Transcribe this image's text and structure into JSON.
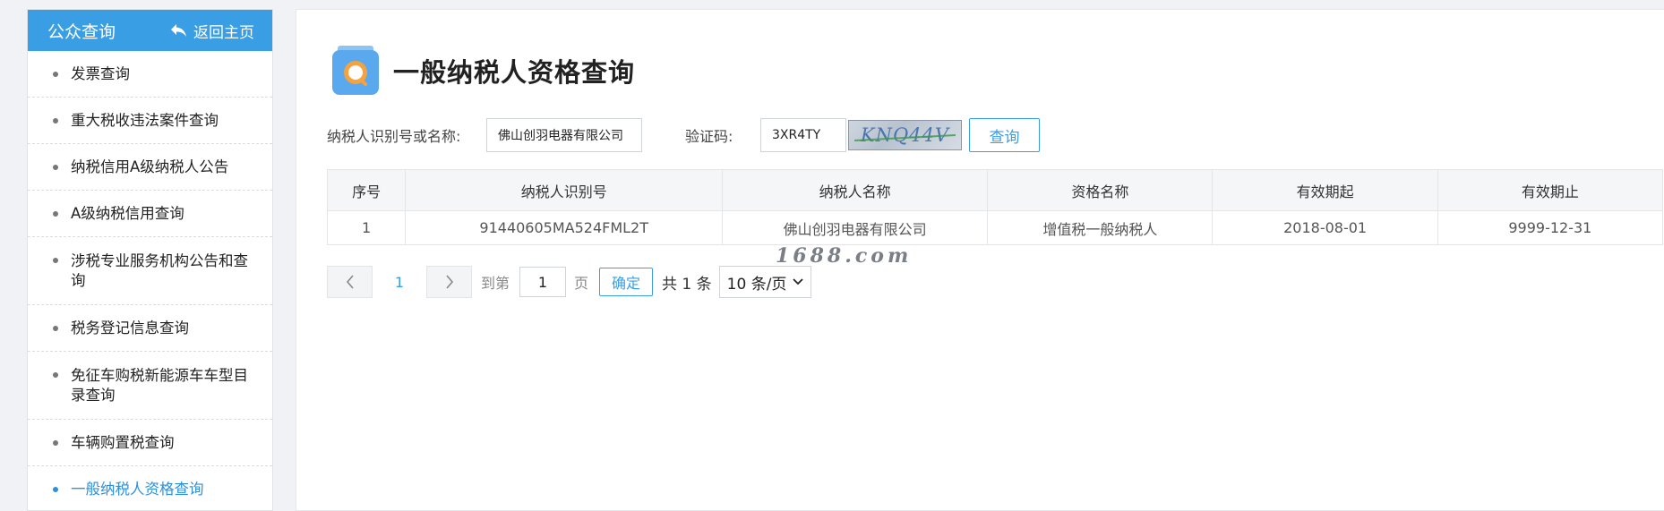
{
  "sidebar": {
    "title": "公众查询",
    "home_link": "返回主页",
    "items": [
      {
        "label": "发票查询"
      },
      {
        "label": "重大税收违法案件查询"
      },
      {
        "label": "纳税信用A级纳税人公告"
      },
      {
        "label": "A级纳税信用查询"
      },
      {
        "label": "涉税专业服务机构公告和查询"
      },
      {
        "label": "税务登记信息查询"
      },
      {
        "label": "免征车购税新能源车车型目录查询"
      },
      {
        "label": "车辆购置税查询"
      },
      {
        "label": "一般纳税人资格查询",
        "active": true
      }
    ]
  },
  "page": {
    "title": "一般纳税人资格查询",
    "icon": "search-document-icon"
  },
  "form": {
    "taxpayer_label": "纳税人识别号或名称:",
    "taxpayer_value": "佛山创羽电器有限公司",
    "code_label": "验证码:",
    "code_value": "3XR4TY",
    "captcha_text": "KNQ44V",
    "query_button": "查询"
  },
  "table": {
    "headers": [
      "序号",
      "纳税人识别号",
      "纳税人名称",
      "资格名称",
      "有效期起",
      "有效期止"
    ],
    "rows": [
      [
        "1",
        "91440605MA524FML2T",
        "佛山创羽电器有限公司",
        "增值税一般纳税人",
        "2018-08-01",
        "9999-12-31"
      ]
    ]
  },
  "watermark": "1688.com",
  "pager": {
    "current_page": "1",
    "goto_prefix": "到第",
    "goto_value": "1",
    "goto_suffix": "页",
    "confirm": "确定",
    "total": "共 1 条",
    "page_size": "10 条/页"
  },
  "colors": {
    "accent": "#3a9ee4",
    "active_menu": "#2e8fdb"
  }
}
